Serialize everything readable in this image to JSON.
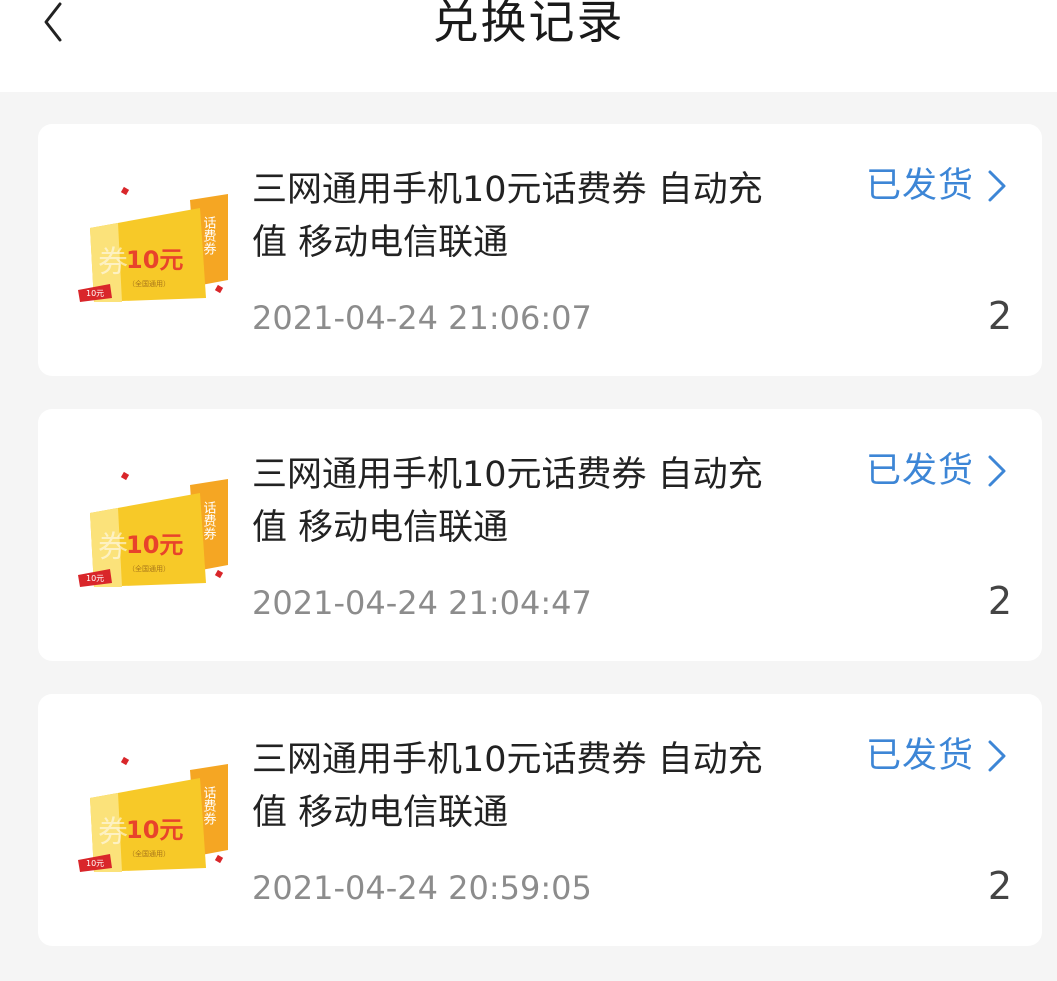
{
  "header": {
    "title": "兑换记录"
  },
  "records": [
    {
      "title": "三网通用手机10元话费券 自动充值 移动电信联通",
      "status": "已发货",
      "time": "2021-04-24 21:06:07",
      "quantity": "2"
    },
    {
      "title": "三网通用手机10元话费券 自动充值 移动电信联通",
      "status": "已发货",
      "time": "2021-04-24 21:04:47",
      "quantity": "2"
    },
    {
      "title": "三网通用手机10元话费券 自动充值 移动电信联通",
      "status": "已发货",
      "time": "2021-04-24 20:59:05",
      "quantity": "2"
    }
  ],
  "coupon_image": {
    "amount": "10元",
    "badge": "10元",
    "side_text": "话费券",
    "bg_char": "券",
    "small_text": "（全国通用）"
  },
  "colors": {
    "accent": "#3d86d6",
    "coupon_yellow": "#f7c928",
    "coupon_orange": "#f5a623",
    "badge_red": "#d9262a"
  },
  "icons": {
    "back": "chevron-left-icon",
    "status_arrow": "chevron-right-icon"
  }
}
